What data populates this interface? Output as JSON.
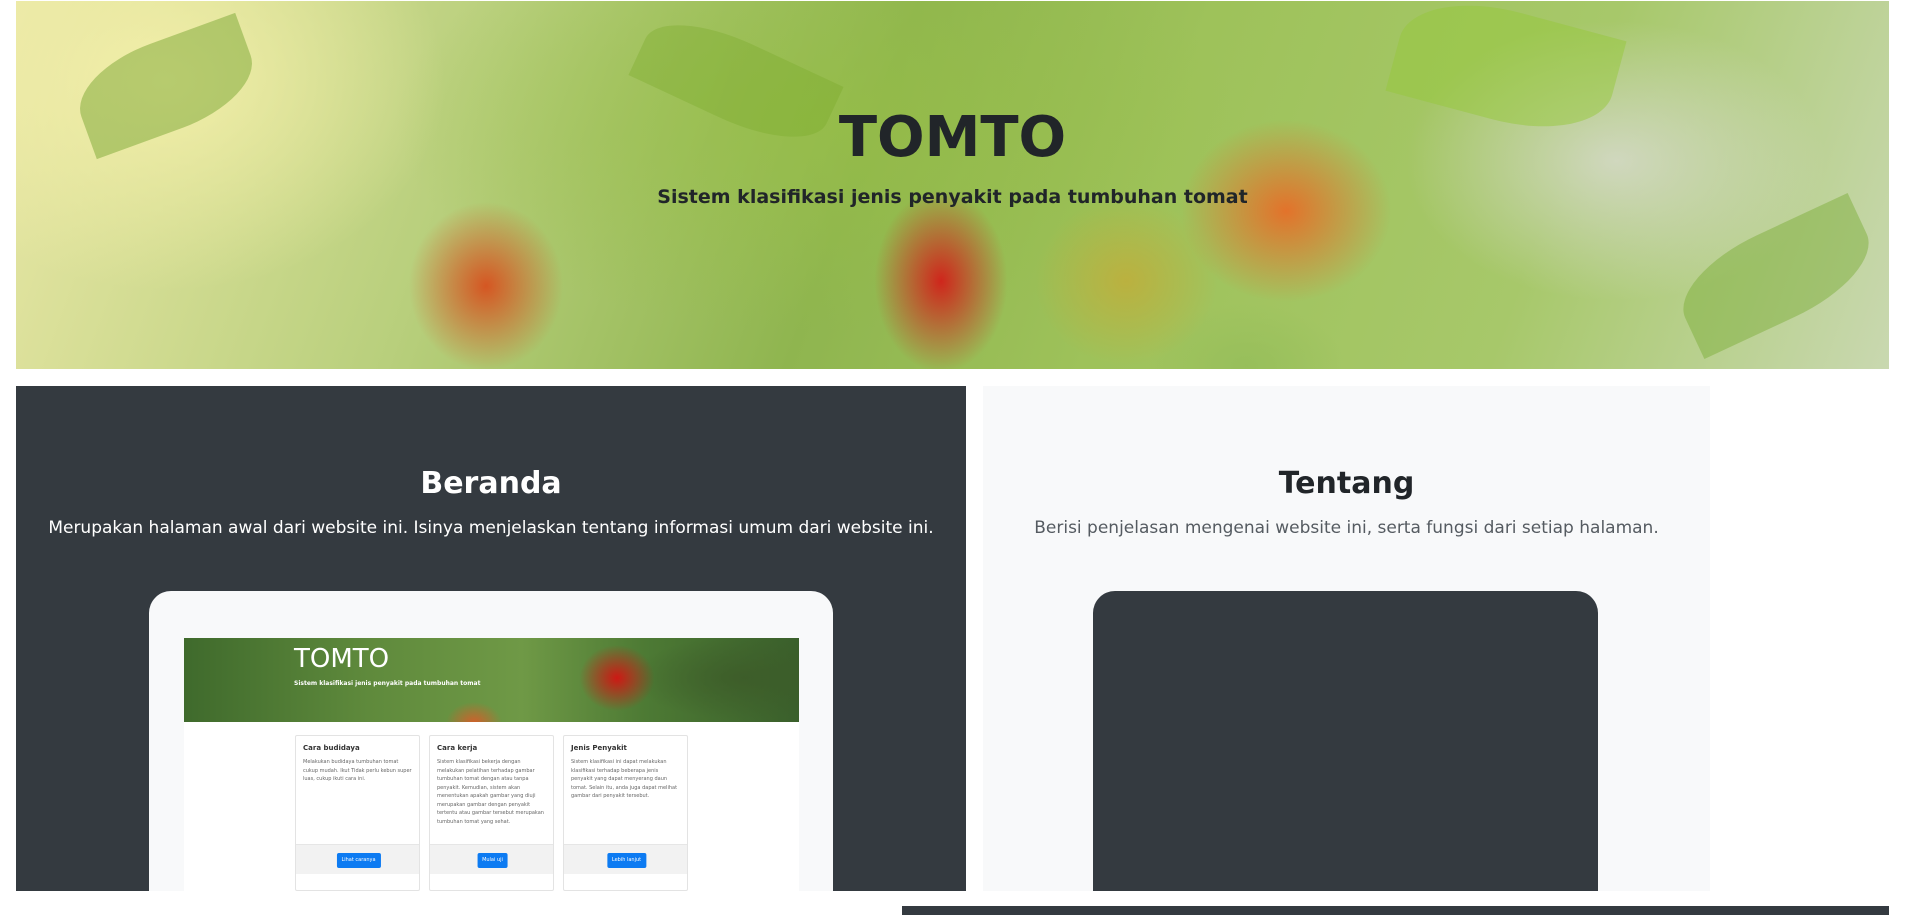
{
  "hero": {
    "title": "TOMTO",
    "subtitle": "Sistem klasifikasi jenis penyakit pada tumbuhan tomat"
  },
  "sections": {
    "beranda": {
      "title": "Beranda",
      "description": "Merupakan halaman awal dari website ini. Isinya menjelaskan tentang informasi umum dari website ini.",
      "preview": {
        "title": "TOMTO",
        "subtitle": "Sistem klasifikasi jenis penyakit pada tumbuhan tomat",
        "cards": [
          {
            "title": "Cara budidaya",
            "text": "Melakukan budidaya tumbuhan tomat cukup mudah. Ikut Tidak perlu kebun super luas, cukup ikuti cara ini.",
            "button": "Lihat caranya"
          },
          {
            "title": "Cara kerja",
            "text": "Sistem klasifikasi bekerja dengan melakukan pelatihan terhadap gambar tumbuhan tomat dengan atau tanpa penyakit. Kemudian, sistem akan menentukan apakah gambar yang diuji merupakan gambar dengan penyakit tertentu atau gambar tersebut merupakan tumbuhan tomat yang sehat.",
            "button": "Mulai uji"
          },
          {
            "title": "Jenis Penyakit",
            "text": "Sistem klasifikasi ini dapat melakukan klasifikasi terhadap beberapa jenis penyakit yang dapat menyerang daun tomat. Selain itu, anda juga dapat melihat gambar dari penyakit tersebut.",
            "button": "Lebih lanjut"
          }
        ]
      }
    },
    "tentang": {
      "title": "Tentang",
      "description": "Berisi penjelasan mengenai website ini, serta fungsi dari setiap halaman."
    }
  },
  "colors": {
    "dark": "#343a40",
    "light": "#f8f9fa",
    "primary_button": "#0d7bf2",
    "text_dark": "#212529"
  }
}
